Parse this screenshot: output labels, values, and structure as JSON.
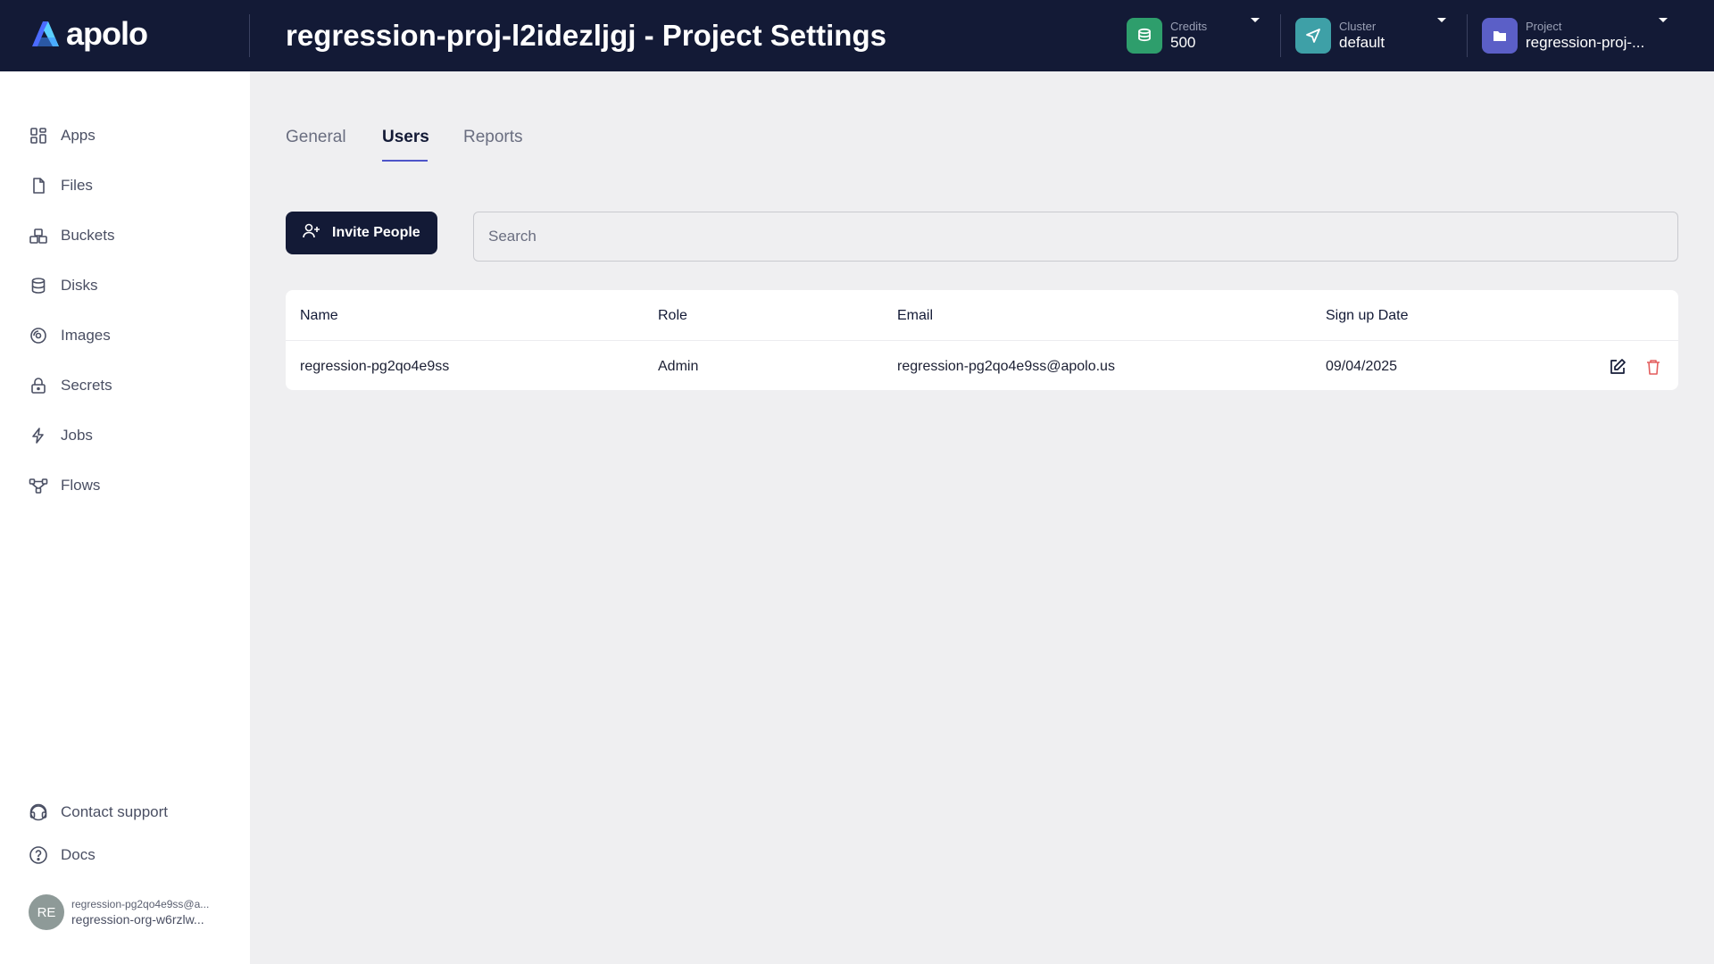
{
  "header": {
    "logo_text": "apolo",
    "title": "regression-proj-l2idezljgj - Project Settings",
    "credits": {
      "caption": "Credits",
      "value": "500",
      "color": "#2e9e6c",
      "icon": "coins-icon"
    },
    "cluster": {
      "caption": "Cluster",
      "value": "default",
      "color": "#3ea0a7",
      "icon": "send-icon"
    },
    "project": {
      "caption": "Project",
      "value": "regression-proj-...",
      "color": "#5b5fc7",
      "icon": "folder-icon"
    }
  },
  "sidebar": {
    "items": [
      {
        "label": "Apps",
        "icon": "apps-grid-icon"
      },
      {
        "label": "Files",
        "icon": "file-icon"
      },
      {
        "label": "Buckets",
        "icon": "buckets-icon"
      },
      {
        "label": "Disks",
        "icon": "database-icon"
      },
      {
        "label": "Images",
        "icon": "disc-icon"
      },
      {
        "label": "Secrets",
        "icon": "lock-icon"
      },
      {
        "label": "Jobs",
        "icon": "lightning-icon"
      },
      {
        "label": "Flows",
        "icon": "flow-icon"
      }
    ],
    "footer": [
      {
        "label": "Contact support",
        "icon": "headset-icon"
      },
      {
        "label": "Docs",
        "icon": "help-circle-icon"
      }
    ],
    "user": {
      "initials": "RE",
      "email": "regression-pg2qo4e9ss@a...",
      "org": "regression-org-w6rzlw..."
    }
  },
  "tabs": [
    {
      "label": "General",
      "active": false
    },
    {
      "label": "Users",
      "active": true
    },
    {
      "label": "Reports",
      "active": false
    }
  ],
  "actions": {
    "invite_label": "Invite People",
    "search_placeholder": "Search"
  },
  "table": {
    "columns": [
      "Name",
      "Role",
      "Email",
      "Sign up Date"
    ],
    "rows": [
      {
        "name": "regression-pg2qo4e9ss",
        "role": "Admin",
        "email": "regression-pg2qo4e9ss@apolo.us",
        "signup": "09/04/2025"
      }
    ]
  },
  "colors": {
    "accent": "#4d55c9",
    "topbar": "#131a36",
    "danger": "#e35d5d"
  }
}
